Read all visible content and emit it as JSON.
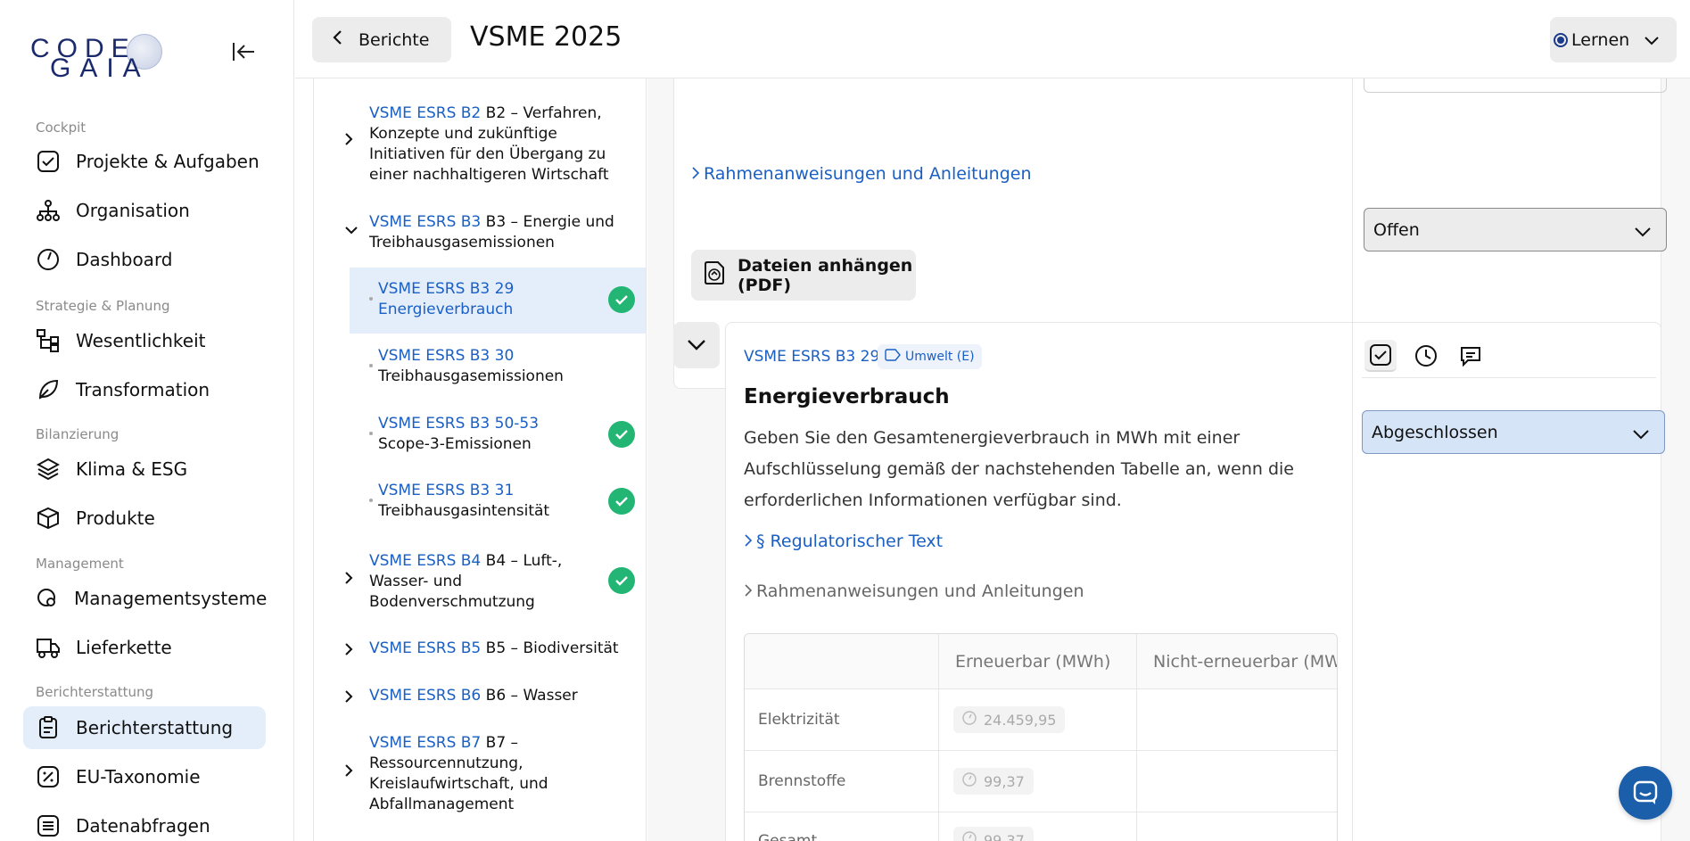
{
  "logo": {
    "line1": "CODE",
    "line2": "GAIA"
  },
  "sidebar": {
    "sections": [
      {
        "label": "Cockpit"
      },
      {
        "label": "Strategie & Planung"
      },
      {
        "label": "Bilanzierung"
      },
      {
        "label": "Management"
      },
      {
        "label": "Berichterstattung"
      }
    ],
    "items": [
      {
        "label": "Projekte & Aufgaben",
        "icon": "check-square-icon"
      },
      {
        "label": "Organisation",
        "icon": "org-chart-icon"
      },
      {
        "label": "Dashboard",
        "icon": "gauge-icon"
      },
      {
        "label": "Wesentlichkeit",
        "icon": "tree-icon"
      },
      {
        "label": "Transformation",
        "icon": "leaf-icon"
      },
      {
        "label": "Klima & ESG",
        "icon": "layers-icon"
      },
      {
        "label": "Produkte",
        "icon": "box-icon"
      },
      {
        "label": "Managementsysteme",
        "icon": "search-gear-icon"
      },
      {
        "label": "Lieferkette",
        "icon": "truck-icon"
      },
      {
        "label": "Berichterstattung",
        "icon": "clipboard-icon",
        "active": true
      },
      {
        "label": "EU-Taxonomie",
        "icon": "percent-icon"
      },
      {
        "label": "Datenabfragen",
        "icon": "list-icon"
      }
    ]
  },
  "topbar": {
    "back_label": "Berichte",
    "title": "VSME 2025",
    "learn_label": "Lernen"
  },
  "tree": {
    "items": [
      {
        "code": "VSME ESRS B2",
        "text": "B2 – Verfahren, Konzepte und zukünftige Initiativen für den Übergang zu einer nachhaltigeren Wirtschaft"
      },
      {
        "code": "VSME ESRS B3",
        "text": "B3 – Energie und Treibhausgasemissionen"
      },
      {
        "code": "VSME ESRS B3 29",
        "text": "Energieverbrauch"
      },
      {
        "code": "VSME ESRS B3 30",
        "text": "Treibhausgasemissionen"
      },
      {
        "code": "VSME ESRS B3 50-53",
        "text": "Scope-3-Emissionen"
      },
      {
        "code": "VSME ESRS B3 31",
        "text": "Treibhausgasintensität"
      },
      {
        "code": "VSME ESRS B4",
        "text": "B4 – Luft-, Wasser- und Bodenverschmutzung"
      },
      {
        "code": "VSME ESRS B5",
        "text": "B5 – Biodiversität"
      },
      {
        "code": "VSME ESRS B6",
        "text": "B6 – Wasser"
      },
      {
        "code": "VSME ESRS B7",
        "text": "B7 – Ressourcennutzung, Kreislaufwirtschaft, und Abfallmanagement"
      }
    ]
  },
  "card1": {
    "guidance_link": "Rahmenanweisungen und Anleitungen",
    "attach_label": "Dateien anhängen (PDF)",
    "status": "Offen"
  },
  "card2": {
    "code": "VSME ESRS B3 29",
    "tag": "Umwelt (E)",
    "title": "Energieverbrauch",
    "description": "Geben Sie den Gesamtenergieverbrauch in MWh mit einer Aufschlüsselung gemäß der nachstehenden Tabelle an, wenn die erforderlichen Informationen verfügbar sind.",
    "regulatory_link": "§ Regulatorischer Text",
    "guidance_link": "Rahmenanweisungen und Anleitungen",
    "status": "Abgeschlossen",
    "table": {
      "headers": [
        "",
        "Erneuerbar (MWh)",
        "Nicht-erneuerbar (MW"
      ],
      "rows": [
        {
          "label": "Elektrizität",
          "renewable": "24.459,95"
        },
        {
          "label": "Brennstoffe",
          "renewable": "99,37"
        },
        {
          "label": "Gesamt",
          "renewable": "99,37"
        }
      ]
    }
  },
  "colors": {
    "accent": "#1a5fc4",
    "success": "#22b573",
    "active_bg": "#e4eefb",
    "status_done_bg": "#d6e4f7"
  }
}
